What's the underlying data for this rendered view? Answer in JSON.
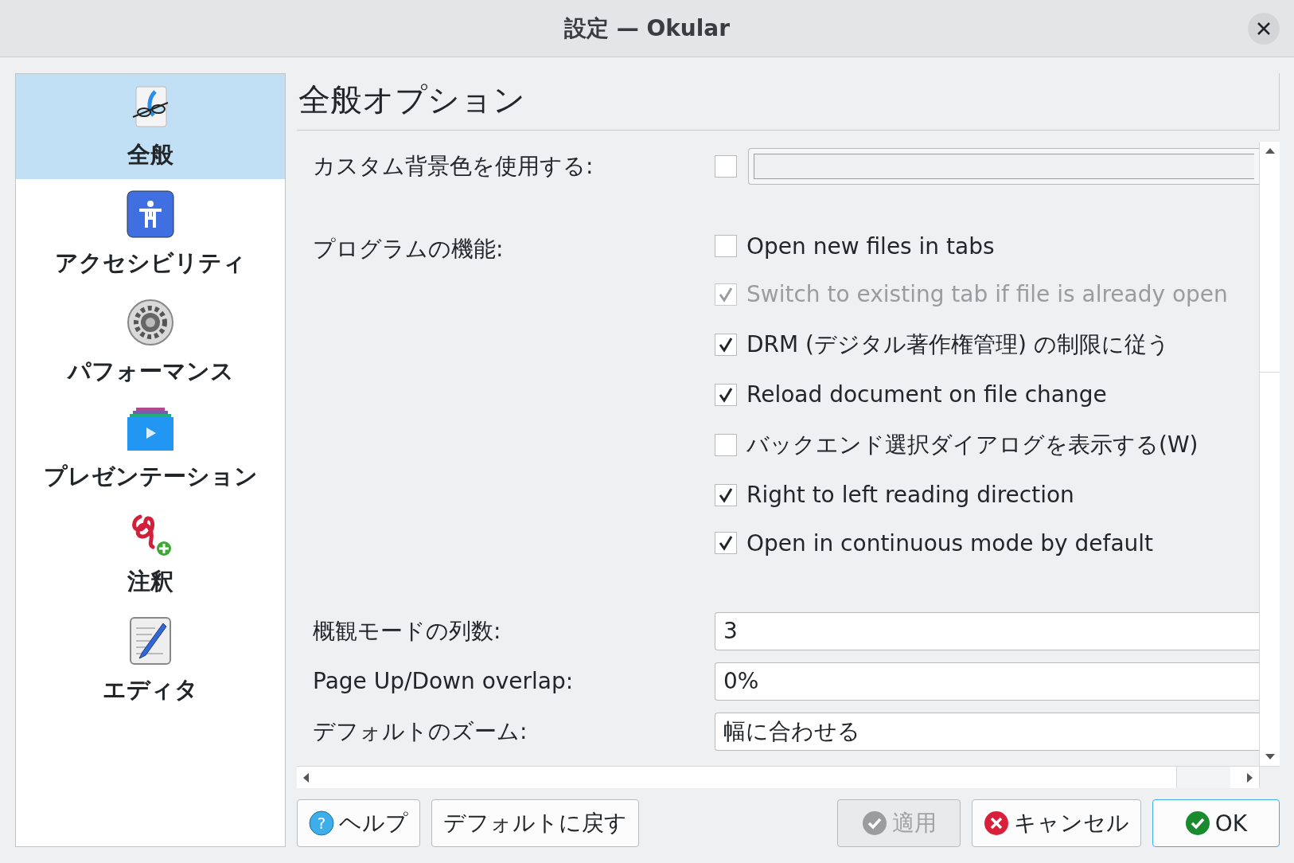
{
  "window": {
    "title": "設定 — Okular"
  },
  "sidebar": {
    "items": [
      {
        "label": "全般",
        "selected": true
      },
      {
        "label": "アクセシビリティ",
        "selected": false
      },
      {
        "label": "パフォーマンス",
        "selected": false
      },
      {
        "label": "プレゼンテーション",
        "selected": false
      },
      {
        "label": "注釈",
        "selected": false
      },
      {
        "label": "エディタ",
        "selected": false
      }
    ]
  },
  "page": {
    "title": "全般オプション",
    "custom_background": {
      "label": "カスタム背景色を使用する:",
      "checked": false
    },
    "program_features": {
      "label": "プログラムの機能:",
      "options": [
        {
          "label": "Open new files in tabs",
          "checked": false,
          "disabled": false
        },
        {
          "label": "Switch to existing tab if file is already open",
          "checked": true,
          "disabled": true
        },
        {
          "label": "DRM (デジタル著作権管理) の制限に従う",
          "checked": true,
          "disabled": false
        },
        {
          "label": "Reload document on file change",
          "checked": true,
          "disabled": false
        },
        {
          "label": "バックエンド選択ダイアログを表示する(W)",
          "checked": false,
          "disabled": false
        },
        {
          "label": "Right to left reading direction",
          "checked": true,
          "disabled": false
        },
        {
          "label": "Open in continuous mode by default",
          "checked": true,
          "disabled": false
        }
      ]
    },
    "fields": [
      {
        "label": "概観モードの列数:",
        "value": "3"
      },
      {
        "label": "Page Up/Down overlap:",
        "value": "0%"
      },
      {
        "label": "デフォルトのズーム:",
        "value": "幅に合わせる"
      }
    ]
  },
  "buttons": [
    {
      "label": "ヘルプ",
      "kind": "help",
      "icon_text": "?",
      "disabled": false
    },
    {
      "label": "デフォルトに戻す",
      "kind": "plain",
      "disabled": false
    },
    {
      "label": "適用",
      "kind": "apply",
      "disabled": true
    },
    {
      "label": "キャンセル",
      "kind": "cancel",
      "disabled": false
    },
    {
      "label": "OK",
      "kind": "ok",
      "disabled": false
    }
  ]
}
